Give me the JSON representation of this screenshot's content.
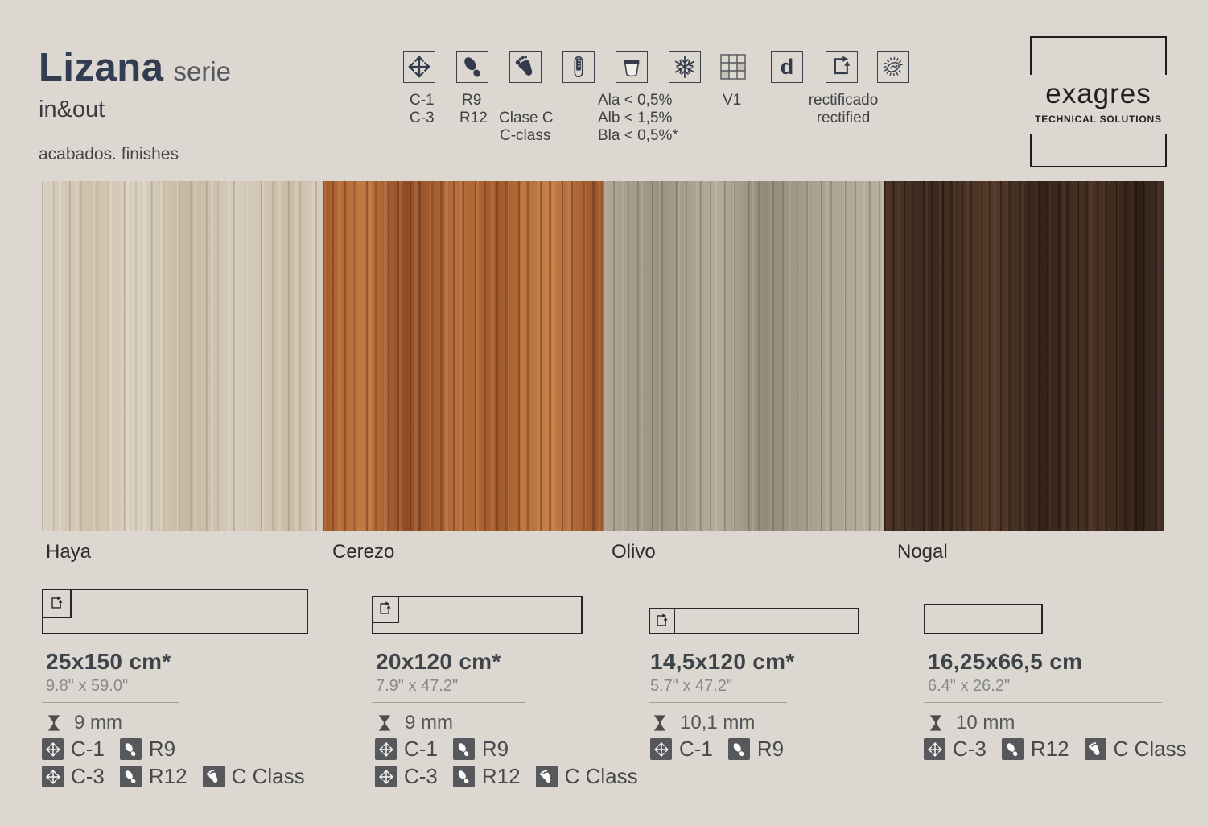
{
  "header": {
    "series_name": "Lizana",
    "series_suffix": "serie",
    "subtitle": "in&out",
    "finishes_label": "acabados. finishes"
  },
  "legend": {
    "d_glyph": "d",
    "labels": {
      "c1": "C-1",
      "c3": "C-3",
      "r9": "R9",
      "r12": "R12",
      "clase_c": "Clase C",
      "c_class": "C-class",
      "ala": "Ala < 0,5%",
      "alb": "Alb < 1,5%",
      "bla": "Bla < 0,5%*",
      "v1": "V1",
      "rectificado": "rectificado",
      "rectified": "rectified"
    },
    "icon_names": [
      "expansion-arrows",
      "shoe-print",
      "barefoot",
      "test-tube",
      "absorption-cup",
      "snowflake",
      "shade-variation-grid",
      "letter-d",
      "rectified-arrow",
      "antibacterial"
    ]
  },
  "logo": {
    "brand": "exagres",
    "tagline": "TECHNICAL SOLUTIONS"
  },
  "colors": {
    "page_bg": "#dcd8d1",
    "icon_ink": "#333b4a",
    "chip_bg": "#57585b",
    "wood_haya": "#d3c8b6",
    "wood_cerezo": "#ad6134",
    "wood_olivo": "#a79e8e",
    "wood_nogal": "#43301f"
  },
  "products": [
    {
      "name": "Haya",
      "size_cm": "25x150 cm*",
      "size_in": "9.8\" x 59.0\"",
      "thickness": "9 mm",
      "row1": {
        "abrasion": "C-1",
        "slip": "R9"
      },
      "row2": {
        "abrasion": "C-3",
        "slip": "R12",
        "barefoot": "C Class"
      }
    },
    {
      "name": "Cerezo",
      "size_cm": "20x120 cm*",
      "size_in": "7.9\" x 47.2\"",
      "thickness": "9 mm",
      "row1": {
        "abrasion": "C-1",
        "slip": "R9"
      },
      "row2": {
        "abrasion": "C-3",
        "slip": "R12",
        "barefoot": "C Class"
      }
    },
    {
      "name": "Olivo",
      "size_cm": "14,5x120 cm*",
      "size_in": "5.7\" x 47.2\"",
      "thickness": "10,1 mm",
      "row1": {
        "abrasion": "C-1",
        "slip": "R9"
      }
    },
    {
      "name": "Nogal",
      "size_cm": "16,25x66,5 cm",
      "size_in": "6.4\" x 26.2\"",
      "thickness": "10 mm",
      "row1": {
        "abrasion": "C-3",
        "slip": "R12",
        "barefoot": "C Class"
      }
    }
  ]
}
